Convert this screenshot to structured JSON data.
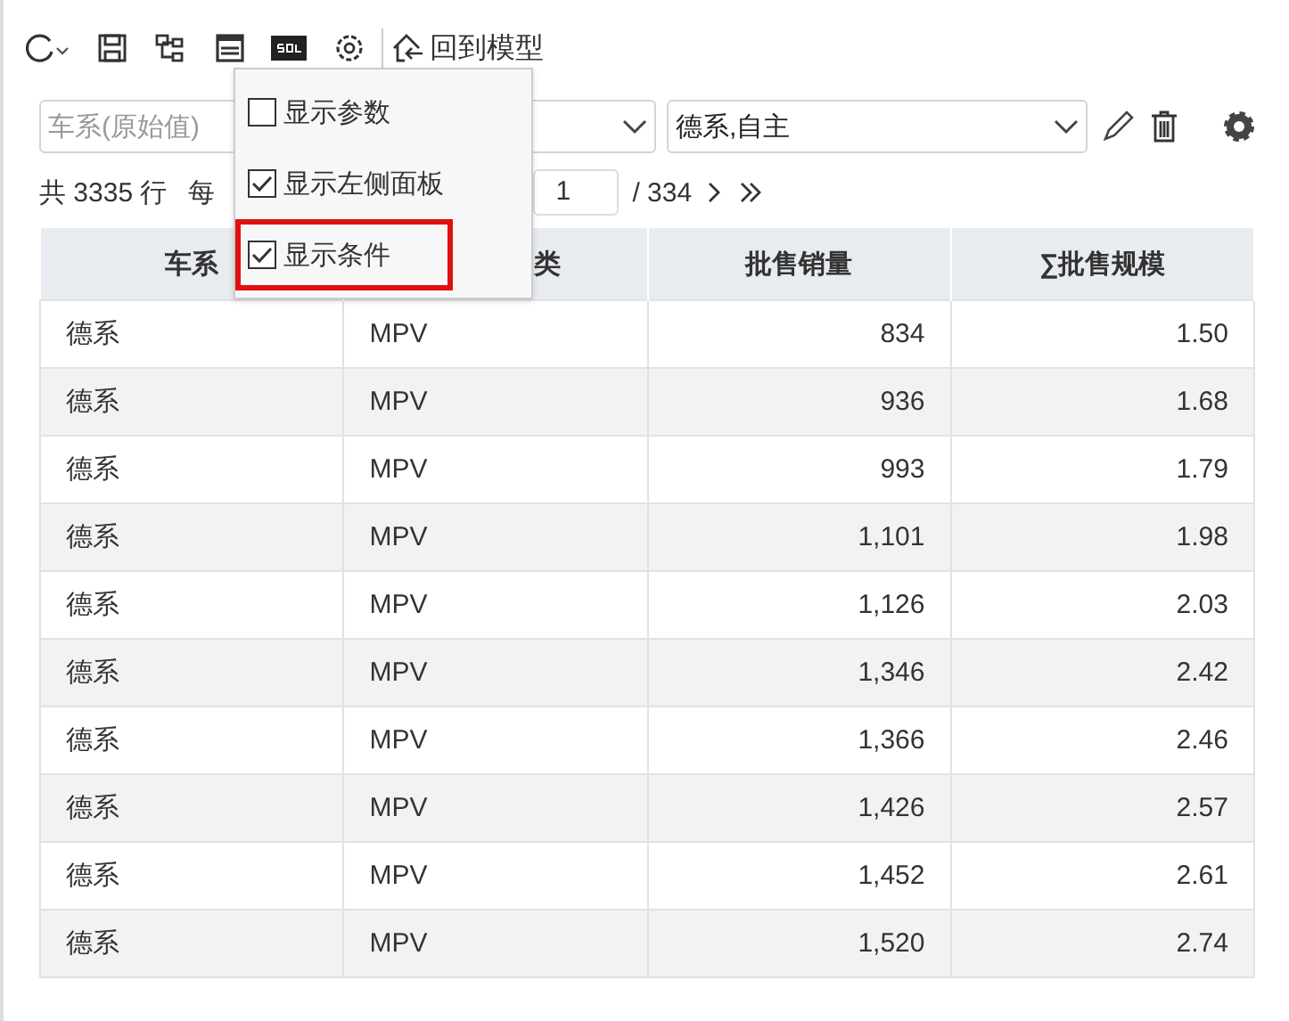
{
  "toolbar": {
    "return_label": "回到模型"
  },
  "filters": [
    {
      "kind": "select",
      "placeholder": "车系(原始值)"
    },
    {
      "kind": "select",
      "value": "德系,自主"
    }
  ],
  "pager": {
    "total": "共 3335 行",
    "per_page": "每",
    "page": "1",
    "pages": "/ 334"
  },
  "menu": {
    "items": [
      {
        "label": "显示参数",
        "checked": false,
        "highlighted": false
      },
      {
        "label": "显示左侧面板",
        "checked": true,
        "highlighted": false
      },
      {
        "label": "显示条件",
        "checked": true,
        "highlighted": true
      }
    ]
  },
  "table": {
    "columns": [
      "车系",
      "类",
      "批售销量",
      "∑批售规模"
    ],
    "rows": [
      [
        "德系",
        "MPV",
        "834",
        "1.50"
      ],
      [
        "德系",
        "MPV",
        "936",
        "1.68"
      ],
      [
        "德系",
        "MPV",
        "993",
        "1.79"
      ],
      [
        "德系",
        "MPV",
        "1,101",
        "1.98"
      ],
      [
        "德系",
        "MPV",
        "1,126",
        "2.03"
      ],
      [
        "德系",
        "MPV",
        "1,346",
        "2.42"
      ],
      [
        "德系",
        "MPV",
        "1,366",
        "2.46"
      ],
      [
        "德系",
        "MPV",
        "1,426",
        "2.57"
      ],
      [
        "德系",
        "MPV",
        "1,452",
        "2.61"
      ],
      [
        "德系",
        "MPV",
        "1,520",
        "2.74"
      ]
    ]
  }
}
